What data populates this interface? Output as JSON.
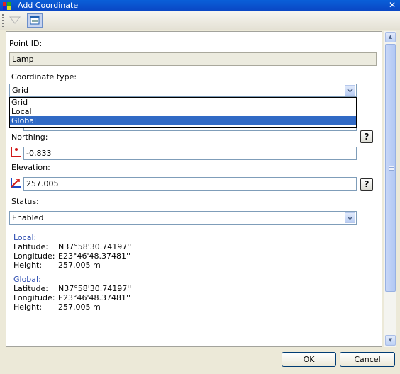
{
  "window": {
    "title": "Add Coordinate"
  },
  "form": {
    "point_id_label": "Point ID:",
    "point_id_value": "Lamp",
    "coord_type_label": "Coordinate type:",
    "coord_type_value": "Grid",
    "coord_type_options": [
      "Grid",
      "Local",
      "Global"
    ],
    "coord_type_highlighted": "Global",
    "northing_label": "Northing:",
    "northing_value": "-0.833",
    "elevation_label": "Elevation:",
    "elevation_value": "257.005",
    "status_label": "Status:",
    "status_value": "Enabled",
    "help_label": "?"
  },
  "info": {
    "local": {
      "heading": "Local:",
      "lat_label": "Latitude:",
      "lat_value": "N37°58'30.74197''",
      "lon_label": "Longitude:",
      "lon_value": "E23°46'48.37481''",
      "h_label": "Height:",
      "h_value": "257.005 m"
    },
    "global": {
      "heading": "Global:",
      "lat_label": "Latitude:",
      "lat_value": "N37°58'30.74197''",
      "lon_label": "Longitude:",
      "lon_value": "E23°46'48.37481''",
      "h_label": "Height:",
      "h_value": "257.005 m"
    }
  },
  "buttons": {
    "ok": "OK",
    "cancel": "Cancel"
  },
  "icons": {
    "close": "close-icon",
    "app": "app-icon",
    "dropdown": "chevron-down-icon",
    "northing": "northing-axis-icon",
    "elevation": "elevation-axis-icon"
  }
}
